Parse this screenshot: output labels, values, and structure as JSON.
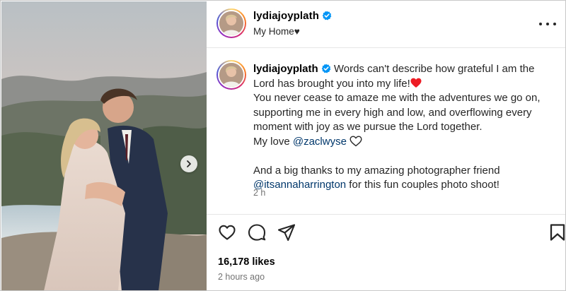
{
  "post": {
    "username": "lydiajoyplath",
    "location": "My Home♥",
    "caption": {
      "line1": "Words can't describe how grateful I am the Lord has brought you into my life!",
      "line2": "You never cease to amaze me with the adventures we go on, supporting me in every high and low, and overflowing every moment with joy as we pursue the Lord together.",
      "line3_prefix": "My love ",
      "mention1": "@zaclwyse",
      "line4": "And a big thanks to my amazing photographer friend ",
      "mention2": "@itsannaharrington",
      "line4_suffix": " for this fun couples photo shoot!"
    },
    "time_short": "2 h",
    "likes": "16,178 likes",
    "time_ago": "2 hours ago"
  },
  "icons": {
    "verified": "verified-badge-icon",
    "more": "more-options-icon",
    "like": "heart-icon",
    "comment": "comment-icon",
    "share": "share-icon",
    "save": "bookmark-icon",
    "next": "chevron-right-icon"
  },
  "colors": {
    "verified": "#0095f6",
    "mention": "#00376b",
    "muted": "#737373",
    "heart": "#ed1c24"
  }
}
